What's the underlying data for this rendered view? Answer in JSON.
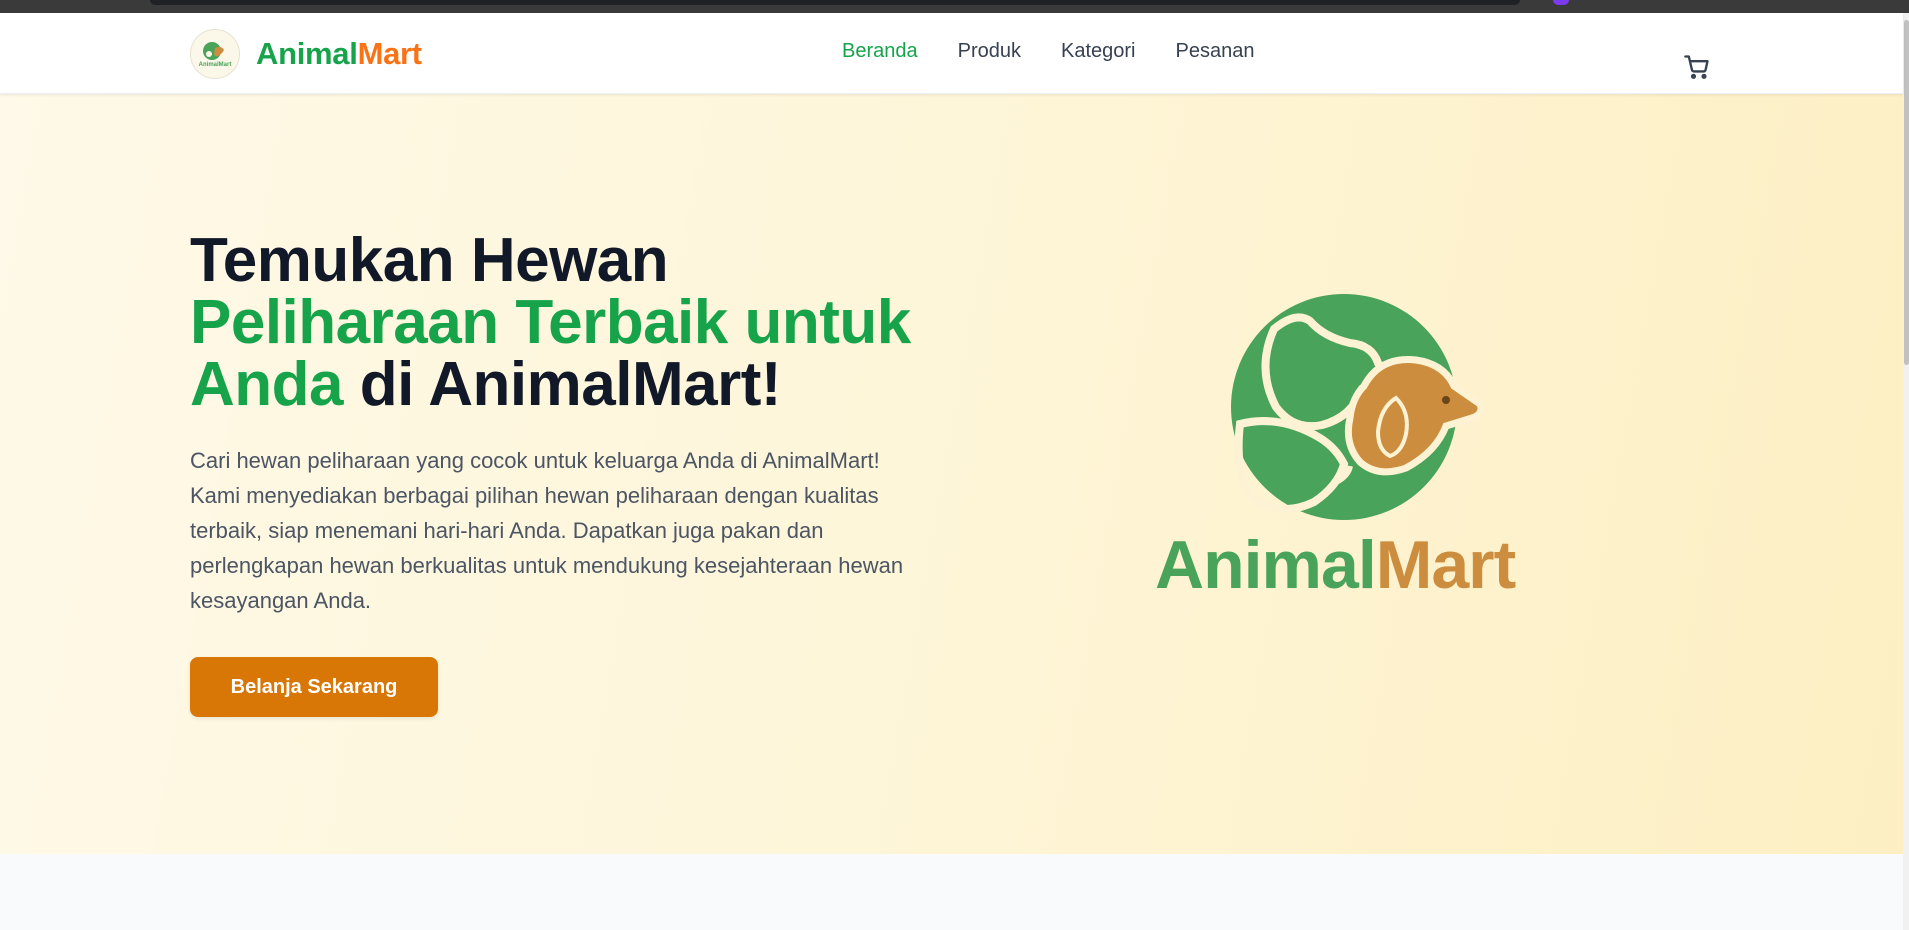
{
  "brand": {
    "name_part1": "Animal",
    "name_part2": "Mart",
    "logo_label": "AnimalMart",
    "primary_color": "#16a34a",
    "accent_color": "#f97316"
  },
  "nav": {
    "items": [
      {
        "label": "Beranda",
        "active": true
      },
      {
        "label": "Produk",
        "active": false
      },
      {
        "label": "Kategori",
        "active": false
      },
      {
        "label": "Pesanan",
        "active": false
      }
    ],
    "cart_icon": "shopping-cart-icon"
  },
  "hero": {
    "title_line1": "Temukan Hewan",
    "title_highlight": "Peliharaan Terbaik untuk Anda",
    "title_rest": " di AnimalMart!",
    "description": "Cari hewan peliharaan yang cocok untuk keluarga Anda di AnimalMart! Kami menyediakan berbagai pilihan hewan peliharaan dengan kualitas terbaik, siap menemani hari-hari Anda. Dapatkan juga pakan dan perlengkapan hewan berkualitas untuk mendukung kesejahteraan hewan kesayangan Anda.",
    "cta_label": "Belanja Sekarang",
    "cta_color": "#d97706",
    "logo_text_part1": "Animal",
    "logo_text_part2": "Mart",
    "logo_green": "#4aa35a",
    "logo_gold": "#cc8e3e"
  }
}
